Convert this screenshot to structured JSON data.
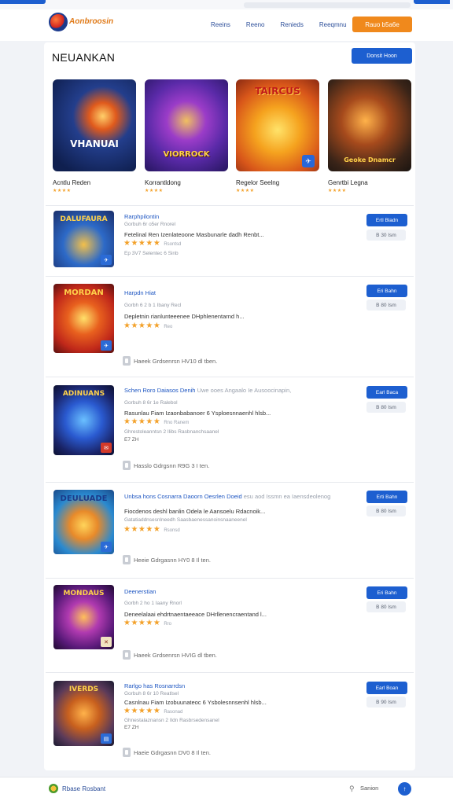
{
  "brand": {
    "logo_text": "Aonbroosin",
    "logo_sub": ""
  },
  "nav": [
    "Reeins",
    "Reeno",
    "Renieds",
    "Reeqmnu"
  ],
  "signin_label": "Rauo b5a6e",
  "page_title": "NEUANKAN",
  "title_button": "Donsit Hoon",
  "featured": [
    {
      "art_text": "VHANUAI",
      "name": "Acntlu Reden",
      "stars": "★★★★"
    },
    {
      "art_text": "VIORROCK",
      "name": "Korrantldong",
      "stars": "★★★★"
    },
    {
      "art_text": "TAIRCUS",
      "name": "Regelor Seelng",
      "stars": "★★★★"
    },
    {
      "art_text": "Geoke Dnamcr",
      "name": "Genrtbi Legna",
      "stars": "★★★★"
    }
  ],
  "rows": [
    {
      "thumb_text": "DALUFAURA",
      "title": "Rarphpilontin",
      "title_extra": "",
      "meta": "Gorbuh 6r o5er Rnorel",
      "desc": "Fetelinal Ren Izenlateoone Masbunarle dadh Renbt...",
      "stars": "★★★★★",
      "count": "Rsontsd",
      "sub": "Ep 3V7 Selentec 6 Sinb",
      "tags": "",
      "footer": "",
      "download": "Ertl Bladn",
      "size": "B 30 Ism"
    },
    {
      "thumb_text": "MORDAN",
      "title": "Harpdn Hiat",
      "title_extra": "",
      "meta": "Gorbh 6 2 b 1 Ibany Recl",
      "desc": "Depletnin rianlunteeenee DHphlenentarnd h...",
      "stars": "★★★★★",
      "count": "Reo",
      "sub": "",
      "tags": "",
      "footer": "Haeek   Grdsenrsn   HV10 dl tben.",
      "download": "Eri Bahn",
      "size": "B 80 Ism"
    },
    {
      "thumb_text": "ADINUANS",
      "title": "Schen Roro Daiasos Denih",
      "title_extra": "Uwe ooes Angaalo Ie Ausoocinapin,",
      "meta": "Gorbuh 8 6r 1e Ralebol",
      "desc": "Rasunlau Fiam Izaonbabanoer 6 Ysploesnnaenhl hlsb...",
      "stars": "★★★★★",
      "count": "Rno Ranem",
      "sub": "Ghrestoleanntsn 2 Ilibs Rasbnanchsaanel",
      "tags": "E7 ZH",
      "footer": "Hasslo   Gdrgsnn   R9G 3 I ten.",
      "download": "Earl Baca",
      "size": "B 80 Ism"
    },
    {
      "thumb_text": "DEULUADE",
      "title": "Unbsa hons Cosnarra Daoorn Oesrlen Doeid",
      "title_extra": "esu aod Issmn ea Iaensdeolenog",
      "meta": "",
      "desc": "Fiocdenos deshl banlin Odela le Aansoelu Rdacnoik...",
      "stars": "★★★★★",
      "count": "Rsonsd",
      "sub": "Gatatiaddnsesnlneedh Saasbaenessanoinsnaaneenel",
      "tags": "",
      "footer": "Heeie   Gdrgasnn   HY0 8 Il ten.",
      "download": "Erti Bahn",
      "size": "B 80 Ism"
    },
    {
      "thumb_text": "MONDAUS",
      "title": "Deenerstian",
      "title_extra": "",
      "meta": "Gorbh 2 ho 1 Iaany Rnorl",
      "desc": "Deneelalaai ehdrtnaentaeeace DHrllenencraentand l...",
      "stars": "★★★★★",
      "count": "Rro",
      "sub": "",
      "tags": "",
      "footer": "Haeek   Grdsenrsn   HVIG dl tben.",
      "download": "Eri Bahn",
      "size": "B 80 Ism"
    },
    {
      "thumb_text": "IVERDS",
      "title": "Rarlgo has Rosnarrdsn",
      "title_extra": "",
      "meta": "Gorbuh 8 6r 10 Reatlsel",
      "desc": "Casnlnau Fiam Izobuunateoc 6 Ysbolesnnsenhl hlsb...",
      "stars": "★★★★★",
      "count": "Rasonad",
      "sub": "Ghnestalaznansn 2 Ildn Rasbrsedensanel",
      "tags": "E7 ZH",
      "footer": "Haeie   Gdrgasnn   DV0 8 Il ten.",
      "download": "Earl Boan",
      "size": "B 90 Ism"
    }
  ],
  "footer": {
    "name": "Rbase Rosbant",
    "search": "Sanion"
  },
  "colors": {
    "primary": "#1d5fd0",
    "accent": "#f0891c",
    "star": "#f3a12a"
  }
}
